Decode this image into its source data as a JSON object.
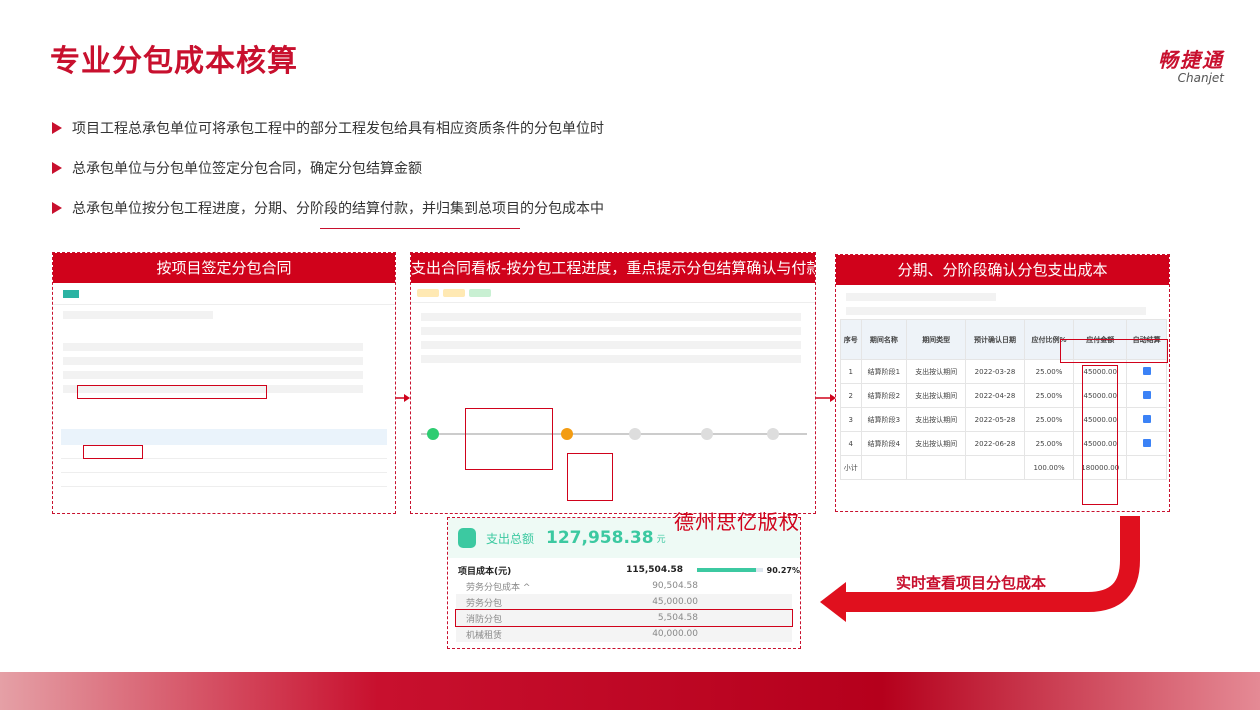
{
  "header": {
    "title": "专业分包成本核算",
    "logo_cn": "畅捷通",
    "logo_en": "Chanjet"
  },
  "bullets": [
    "项目工程总承包单位可将承包工程中的部分工程发包给具有相应资质条件的分包单位时",
    "总承包单位与分包单位签定分包合同，确定分包结算金额",
    "总承包单位按分包工程进度，分期、分阶段的结算付款，并归集到总项目的分包成本中"
  ],
  "panels": {
    "contract": {
      "heading": "按项目签定分包合同"
    },
    "board": {
      "heading": "支出合同看板-按分包工程进度，重点提示分包结算确认与付款"
    },
    "confirm": {
      "heading": "分期、分阶段确认分包支出成本"
    }
  },
  "confirm_table": {
    "headers": [
      "序号",
      "期间名称",
      "期间类型",
      "预计确认日期",
      "应付比例%",
      "应付金额",
      "自动结算"
    ],
    "rows": [
      {
        "no": "1",
        "name": "结算阶段1",
        "type": "支出按认期间",
        "date": "2022-03-28",
        "pct": "25.00%",
        "amount": "45000.00"
      },
      {
        "no": "2",
        "name": "结算阶段2",
        "type": "支出按认期间",
        "date": "2022-04-28",
        "pct": "25.00%",
        "amount": "45000.00"
      },
      {
        "no": "3",
        "name": "结算阶段3",
        "type": "支出按认期间",
        "date": "2022-05-28",
        "pct": "25.00%",
        "amount": "45000.00"
      },
      {
        "no": "4",
        "name": "结算阶段4",
        "type": "支出按认期间",
        "date": "2022-06-28",
        "pct": "25.00%",
        "amount": "45000.00"
      }
    ],
    "total_label": "小计",
    "total_pct": "100.00%",
    "total_amount": "180000.00"
  },
  "cost_summary": {
    "total_label": "支出总额",
    "total_value": "127,958.38",
    "total_unit": "元",
    "project_cost_label": "项目成本(元)",
    "project_cost_value": "115,504.58",
    "project_cost_pct": "90.27%",
    "project_cost_ratio": 0.9027,
    "items": [
      {
        "label": "劳务分包成本 ^",
        "value": "90,504.58"
      },
      {
        "label": "劳务分包",
        "value": "45,000.00"
      },
      {
        "label": "消防分包",
        "value": "5,504.58"
      },
      {
        "label": "机械租赁",
        "value": "40,000.00"
      }
    ]
  },
  "watermark": "德州思亿版权",
  "callout": "实时查看项目分包成本",
  "colors": {
    "brand_red": "#c8102e",
    "accent_green": "#3cc9a1"
  }
}
